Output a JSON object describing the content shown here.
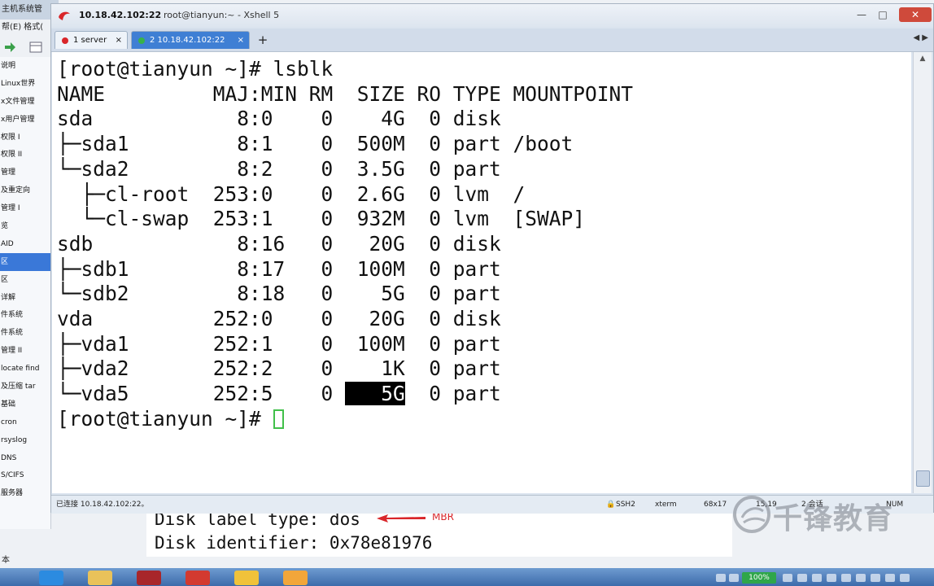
{
  "background_app": {
    "title": "主机系统管",
    "menu": "帮(E)  格式(",
    "sidebar_items": [
      "说明",
      "Linux世界",
      "x文件管理",
      "x用户管理",
      "权限 I",
      "权限 II",
      "管理",
      "及重定向",
      "管理 I",
      "览",
      "AID",
      "区",
      "区",
      "详解",
      "件系统",
      "件系统",
      "管理 II",
      "locate find",
      "及压缩 tar",
      "基础",
      "cron",
      "rsyslog",
      "DNS",
      "S/CIFS",
      "服务器"
    ],
    "selected_index": 11,
    "bottom_text": "本"
  },
  "window": {
    "title_ip": "10.18.42.102:22",
    "title_main": "root@tianyun:~ - Xshell 5",
    "minimize": "—",
    "maximize": "□",
    "close": "✕"
  },
  "tabs": [
    {
      "label": "1 server",
      "close": "×"
    },
    {
      "label": "2 10.18.42.102:22",
      "close": "×",
      "active": true
    }
  ],
  "tab_add": "+",
  "tab_scroll": "◀ ▶",
  "terminal": {
    "lines": [
      "[root@tianyun ~]# lsblk",
      "NAME         MAJ:MIN RM  SIZE RO TYPE MOUNTPOINT",
      "sda            8:0    0    4G  0 disk",
      "├─sda1         8:1    0  500M  0 part /boot",
      "└─sda2         8:2    0  3.5G  0 part",
      "  ├─cl-root  253:0    0  2.6G  0 lvm  /",
      "  └─cl-swap  253:1    0  932M  0 lvm  [SWAP]",
      "sdb            8:16   0   20G  0 disk",
      "├─sdb1         8:17   0  100M  0 part",
      "└─sdb2         8:18   0    5G  0 part",
      "vda          252:0    0   20G  0 disk",
      "├─vda1       252:1    0  100M  0 part",
      "├─vda2       252:2    0    1K  0 part",
      "└─vda5       252:5    0 "
    ],
    "last_row_highlight": "   5G",
    "last_row_tail": "  0 part",
    "prompt": "[root@tianyun ~]# "
  },
  "status_bar": {
    "connection": "已连接 10.18.42.102:22。",
    "protocol": "SSH2",
    "terminal_type": "xterm",
    "size": "68x17",
    "cursor_pos": "15,19",
    "sessions": "2 会话",
    "numlock": "NUM"
  },
  "behind_text": {
    "disk_label": "Disk label type: dos",
    "disk_identifier": "Disk identifier: 0x78e81976",
    "annotation": "MBR",
    "annotation_color": "#d9262a"
  },
  "watermark": {
    "text": "千锋教育"
  },
  "taskbar": {
    "battery": "100%"
  }
}
